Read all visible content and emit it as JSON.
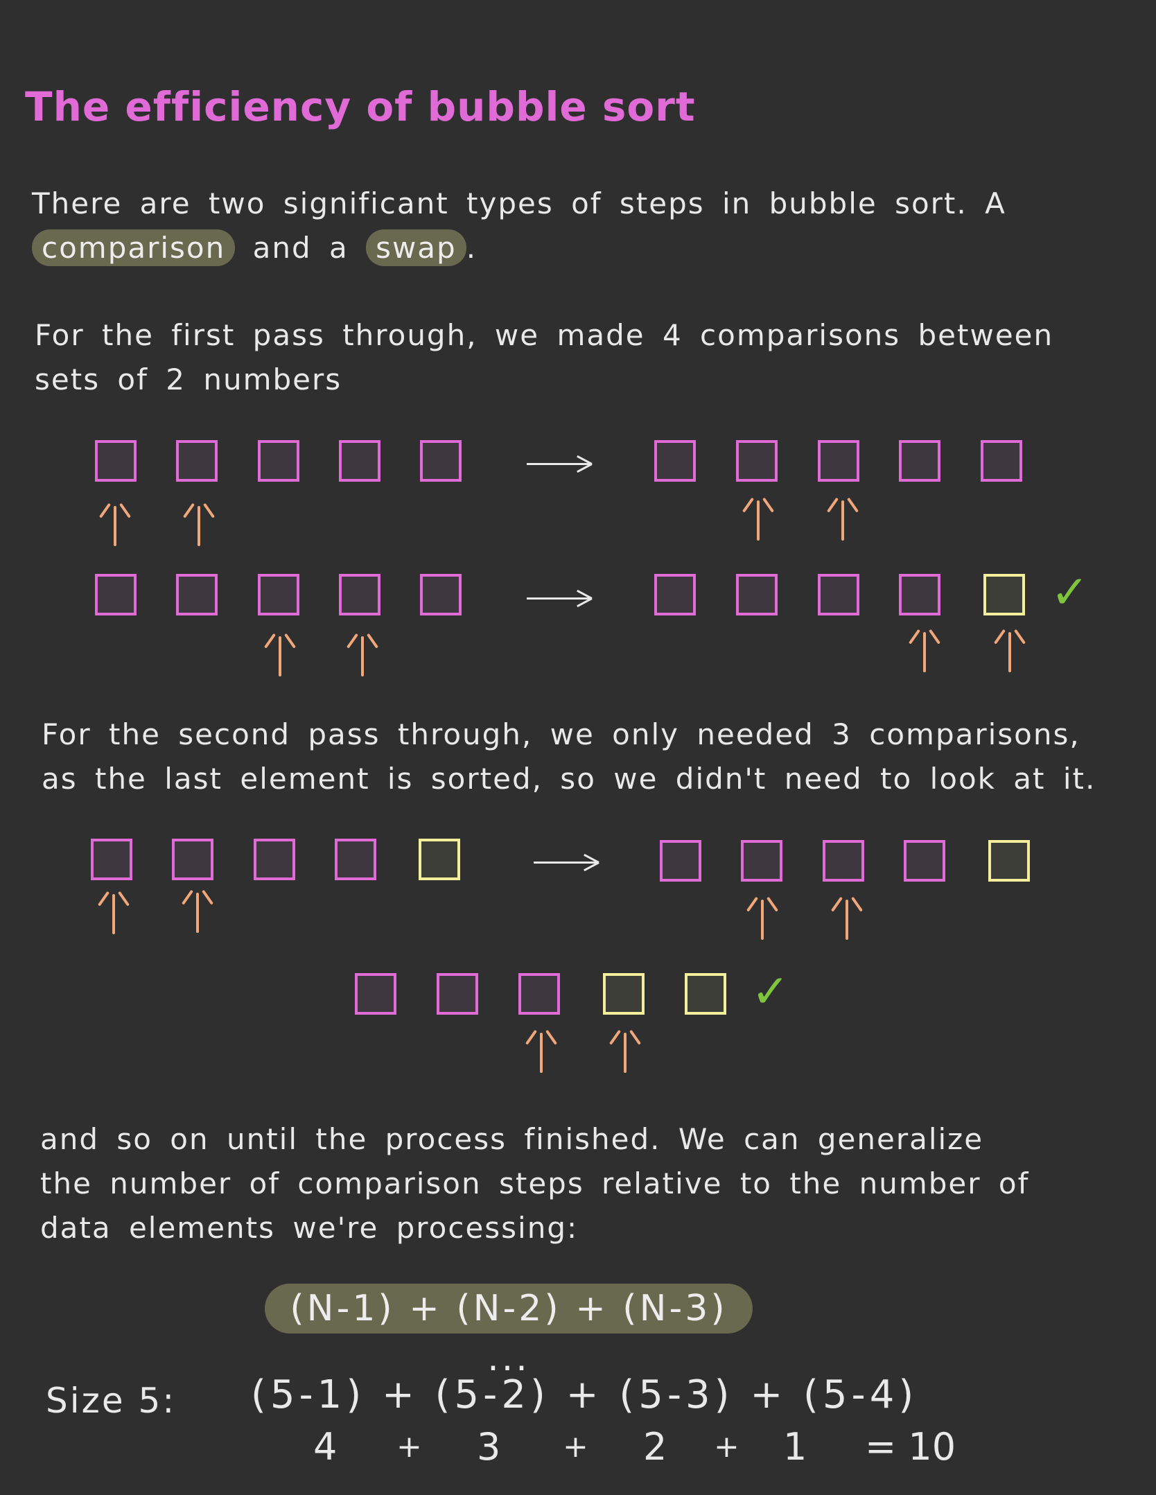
{
  "title": "The efficiency of bubble sort",
  "intro": {
    "line1": "There are two significant types of steps in bubble sort. A",
    "pill1": "comparison",
    "and": "and a",
    "pill2": "swap",
    "end": "."
  },
  "first_pass": {
    "line1": "For the first pass through, we made 4 comparisons between",
    "line2": "sets of 2 numbers"
  },
  "second_pass": {
    "line1": "For the second pass through, we only needed 3 comparisons,",
    "line2": "as the last element is sorted, so we didn't need to look at it."
  },
  "generalize": {
    "line1": "and so on until the process finished. We can generalize",
    "line2": "the number of comparison steps relative to the number of",
    "line3": "data elements we're processing:"
  },
  "formula": "(N-1) + (N-2) + (N-3) ...",
  "example": {
    "label": "Size 5:",
    "expression": "(5-1) + (5-2) + (5-3) + (5-4)",
    "terms": [
      "4",
      "+",
      "3",
      "+",
      "2",
      "+",
      "1"
    ],
    "result": "= 10"
  },
  "colors": {
    "unsorted": "#e06bd6",
    "sorted": "#f2ee9b",
    "arrow": "#f1a77a",
    "check": "#7cc53d",
    "pill": "#68694f"
  },
  "icons": [
    "up-arrow-icon",
    "right-arrow-icon",
    "checkmark-icon"
  ]
}
